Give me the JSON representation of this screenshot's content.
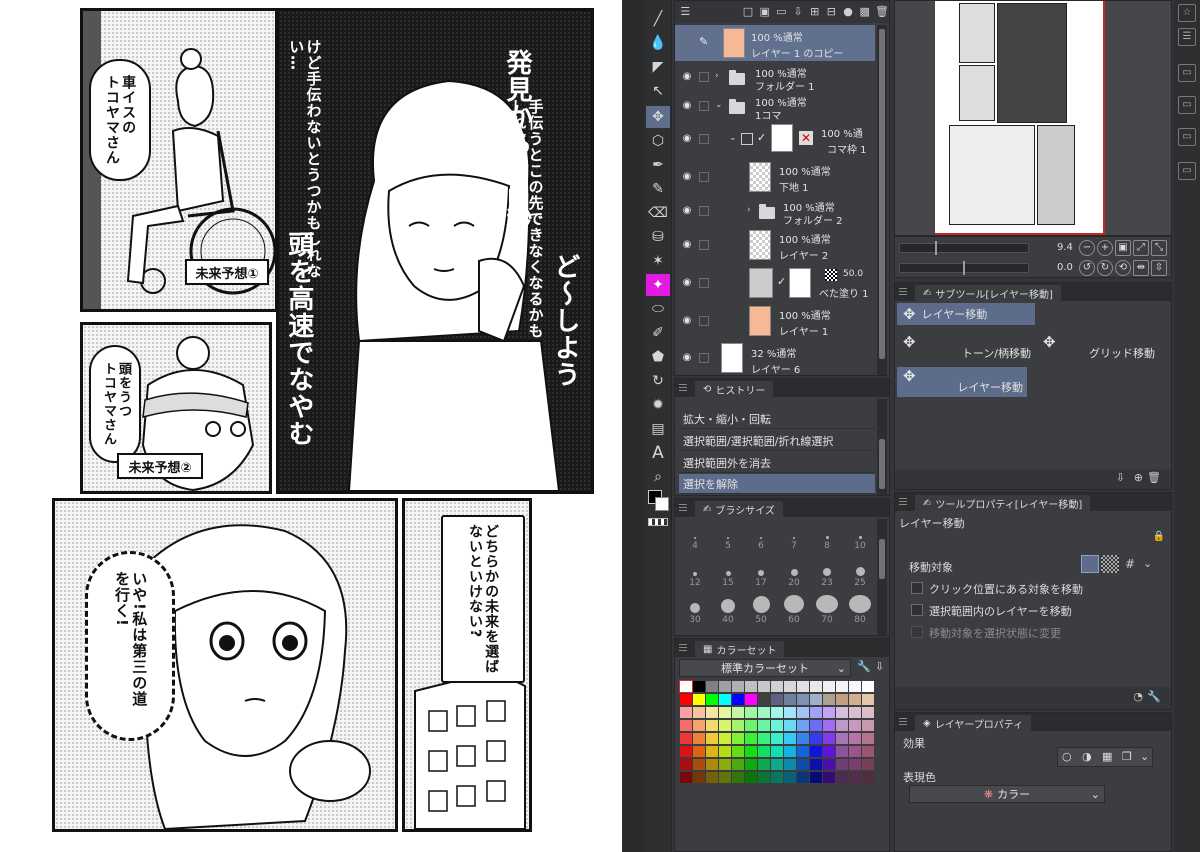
{
  "manga": {
    "panel1": {
      "bubble": "車イスの\nトコヤマさん",
      "caption": "未来予想①"
    },
    "panel2": {
      "title": "発見から0.2秒",
      "monologue": "手伝うとこの先できなくなるかもしれない",
      "monologue2": "けど手伝わないとうつかもしれない…",
      "sfx_doushiyou": "ど〜しよう",
      "sfx_zunou": "頭を高速でなやむ"
    },
    "panel3": {
      "bubble": "頭をうつ\nトコヤマさん",
      "caption": "未来予想②"
    },
    "panel4": {
      "thought": "いや!私は第三の道を行く!"
    },
    "panel5": {
      "bubble": "どちらかの未来を選ばないといけない?"
    }
  },
  "layers_panel": {
    "rows": [
      {
        "mode": "100 %通常",
        "name": "レイヤー 1 のコピー",
        "kind": "layer",
        "thumb": "peach",
        "selected": true
      },
      {
        "mode": "100 %通常",
        "name": "フォルダー 1",
        "kind": "folder",
        "collapsed": true
      },
      {
        "mode": "100 %通常",
        "name": "1コマ",
        "kind": "folder",
        "collapsed": false
      },
      {
        "mode": "100 %通",
        "name": "コマ枠 1",
        "kind": "frame"
      },
      {
        "mode": "100 %通常",
        "name": "下地 1",
        "kind": "layer",
        "thumb": "checker"
      },
      {
        "mode": "100 %通常",
        "name": "フォルダー 2",
        "kind": "folder",
        "collapsed": true
      },
      {
        "mode": "100 %通常",
        "name": "レイヤー 2",
        "kind": "layer",
        "thumb": "checker"
      },
      {
        "mode": "50.0",
        "name": "べた塗り 1",
        "kind": "fill",
        "thumb": "white"
      },
      {
        "mode": "100 %通常",
        "name": "レイヤー 1",
        "kind": "layer",
        "thumb": "peach"
      },
      {
        "mode": "32 %通常",
        "name": "レイヤー 6",
        "kind": "layer",
        "thumb": "sketch"
      }
    ]
  },
  "history_panel": {
    "title": "ヒストリー",
    "items": [
      "拡大・縮小・回転",
      "選択範囲/選択範囲/折れ線選択",
      "選択範囲外を消去",
      "選択を解除"
    ],
    "selected_index": 3
  },
  "brush_panel": {
    "title": "ブラシサイズ",
    "sizes": [
      "4",
      "5",
      "6",
      "7",
      "8",
      "10",
      "12",
      "15",
      "17",
      "20",
      "23",
      "25",
      "30",
      "40",
      "50",
      "60",
      "70",
      "80"
    ]
  },
  "color_panel": {
    "title": "カラーセット",
    "selected_set": "標準カラーセット"
  },
  "navigator": {
    "zoom": "9.4",
    "rotation": "0.0"
  },
  "subtool_panel": {
    "title": "サブツール[レイヤー移動]",
    "items": [
      "レイヤー移動",
      "トーン/柄移動",
      "グリッド移動",
      "レイヤー移動"
    ]
  },
  "tool_property_panel": {
    "title": "ツールプロパティ[レイヤー移動]",
    "tool_name": "レイヤー移動",
    "move_target_label": "移動対象",
    "options": [
      "クリック位置にある対象を移動",
      "選択範囲内のレイヤーを移動",
      "移動対象を選択状態に変更"
    ]
  },
  "layer_property_panel": {
    "title": "レイヤープロパティ",
    "effect_label": "効果",
    "expression_color_label": "表現色",
    "expression_color_value": "カラー"
  },
  "colors": {
    "selection": "#5d6c8b",
    "panel_bg": "#3b3d40",
    "magenta_tool": "#e11be0"
  }
}
